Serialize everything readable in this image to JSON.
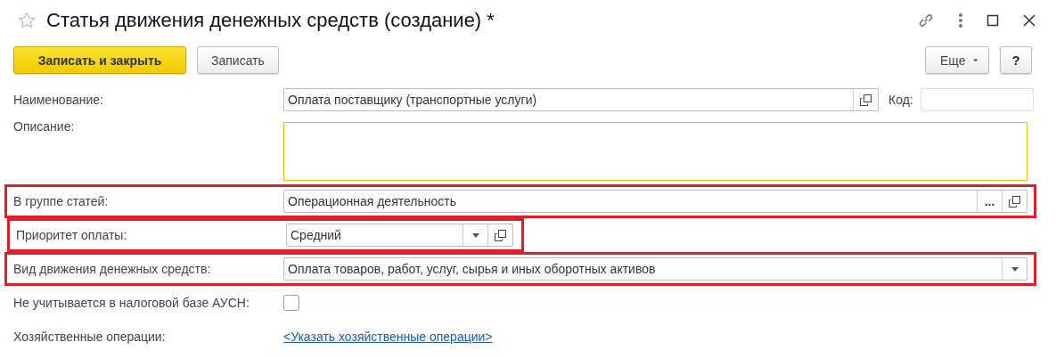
{
  "window": {
    "title": "Статья движения денежных средств (создание) *",
    "favorite": false
  },
  "toolbar": {
    "buttons": [
      {
        "label": "Записать и закрыть",
        "kind": "primary"
      },
      {
        "label": "Записать",
        "kind": "normal"
      }
    ],
    "more": "Еще",
    "help": "?"
  },
  "fields": [
    {
      "label": "Наименование:",
      "kind": "text",
      "value": "Оплата поставщику (транспортные услуги)",
      "buttons": [
        {
          "kind": "open"
        }
      ],
      "highlighted": false,
      "extra": {
        "label": "Код:"
      }
    },
    {
      "label": "Описание:",
      "kind": "textarea",
      "focused": true,
      "highlighted": false
    },
    {
      "label": "В группе статей:",
      "kind": "text",
      "value": "Операционная деятельность",
      "buttons": [
        {
          "kind": "choose",
          "label": "..."
        },
        {
          "kind": "open"
        }
      ],
      "highlighted": true
    },
    {
      "label": "Приоритет оплаты:",
      "kind": "select",
      "value": "Средний",
      "buttons": [
        {
          "kind": "dropdown"
        },
        {
          "kind": "open"
        }
      ],
      "highlighted": true,
      "narrow": true
    },
    {
      "label": "Вид движения денежных средств:",
      "kind": "select",
      "value": "Оплата товаров, работ, услуг, сырья и иных оборотных активов",
      "buttons": [
        {
          "kind": "dropdown"
        }
      ],
      "highlighted": true
    },
    {
      "label": "Не учитывается в налоговой базе АУСН:",
      "kind": "checkbox",
      "checked": false,
      "highlighted": false
    },
    {
      "label": "Хозяйственные операции:",
      "kind": "link",
      "value": "<Указать хозяйственные операции>",
      "highlighted": false
    }
  ]
}
